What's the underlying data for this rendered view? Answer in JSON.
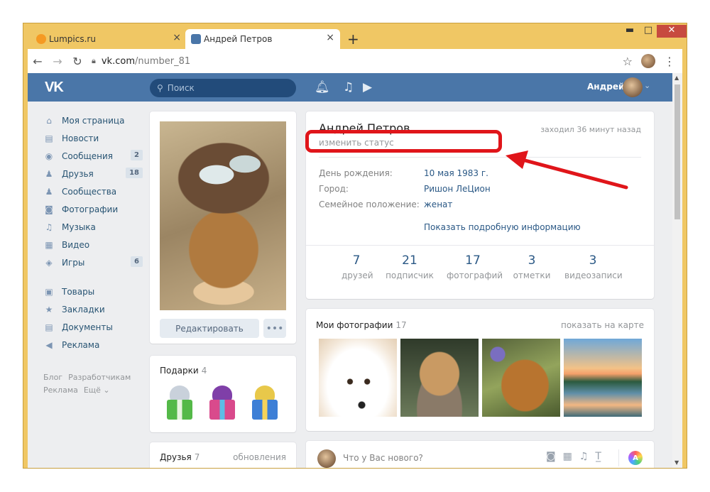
{
  "browser": {
    "tabs": [
      {
        "label": "Lumpics.ru",
        "favicon_color": "#f59a23"
      },
      {
        "label": "Андрей Петров",
        "favicon_color": "#4a76a8"
      }
    ],
    "tab_close_glyph": "×",
    "new_tab_glyph": "+",
    "url_domain": "vk.com",
    "url_path": "/number_81",
    "window_controls": {
      "min": "▬",
      "max": "□",
      "close": "✕"
    },
    "nav": {
      "back": "←",
      "forward": "→",
      "reload": "↻"
    },
    "star_glyph": "☆",
    "menu_glyph": "⋮"
  },
  "vk": {
    "logo": "VK",
    "search_placeholder": "Поиск",
    "header_user": "Андрей",
    "accent": "#4a76a8",
    "menu": [
      {
        "label": "Моя страница",
        "icon": "home-icon",
        "glyph": "⌂"
      },
      {
        "label": "Новости",
        "icon": "news-icon",
        "glyph": "▤"
      },
      {
        "label": "Сообщения",
        "icon": "messages-icon",
        "glyph": "◉",
        "count": "2"
      },
      {
        "label": "Друзья",
        "icon": "friends-icon",
        "glyph": "♟",
        "count": "18"
      },
      {
        "label": "Сообщества",
        "icon": "communities-icon",
        "glyph": "♟"
      },
      {
        "label": "Фотографии",
        "icon": "camera-icon",
        "glyph": "◙"
      },
      {
        "label": "Музыка",
        "icon": "music-icon",
        "glyph": "♫"
      },
      {
        "label": "Видео",
        "icon": "video-icon",
        "glyph": "▦"
      },
      {
        "label": "Игры",
        "icon": "gamepad-icon",
        "glyph": "◈",
        "count": "6"
      }
    ],
    "menu2": [
      {
        "label": "Товары",
        "icon": "bag-icon",
        "glyph": "▣"
      },
      {
        "label": "Закладки",
        "icon": "star-icon",
        "glyph": "★"
      },
      {
        "label": "Документы",
        "icon": "document-icon",
        "glyph": "▤"
      },
      {
        "label": "Реклама",
        "icon": "megaphone-icon",
        "glyph": "◀"
      }
    ],
    "footer": [
      "Блог",
      "Разработчикам",
      "Реклама",
      "Ещё ⌄"
    ],
    "edit_button": "Редактировать",
    "more_button": "•••",
    "gifts": {
      "title": "Подарки",
      "count": "4"
    },
    "friends": {
      "title": "Друзья",
      "count": "7",
      "right": "обновления"
    },
    "profile": {
      "name": "Андрей Петров",
      "status": "изменить статус",
      "last_seen": "заходил 36 минут назад",
      "rows": [
        {
          "label": "День рождения:",
          "value": "10 мая 1983 г."
        },
        {
          "label": "Город:",
          "value": "Ришон ЛеЦион"
        },
        {
          "label": "Семейное положение:",
          "value": "женат"
        }
      ],
      "more_info": "Показать подробную информацию",
      "counters": [
        {
          "num": "7",
          "label": "друзей"
        },
        {
          "num": "21",
          "label": "подписчик"
        },
        {
          "num": "17",
          "label": "фотографий"
        },
        {
          "num": "3",
          "label": "отметки"
        },
        {
          "num": "3",
          "label": "видеозаписи"
        }
      ]
    },
    "photos": {
      "title": "Мои фотографии",
      "count": "17",
      "right": "показать на карте"
    },
    "post": {
      "placeholder": "Что у Вас нового?",
      "badge": "A"
    }
  }
}
